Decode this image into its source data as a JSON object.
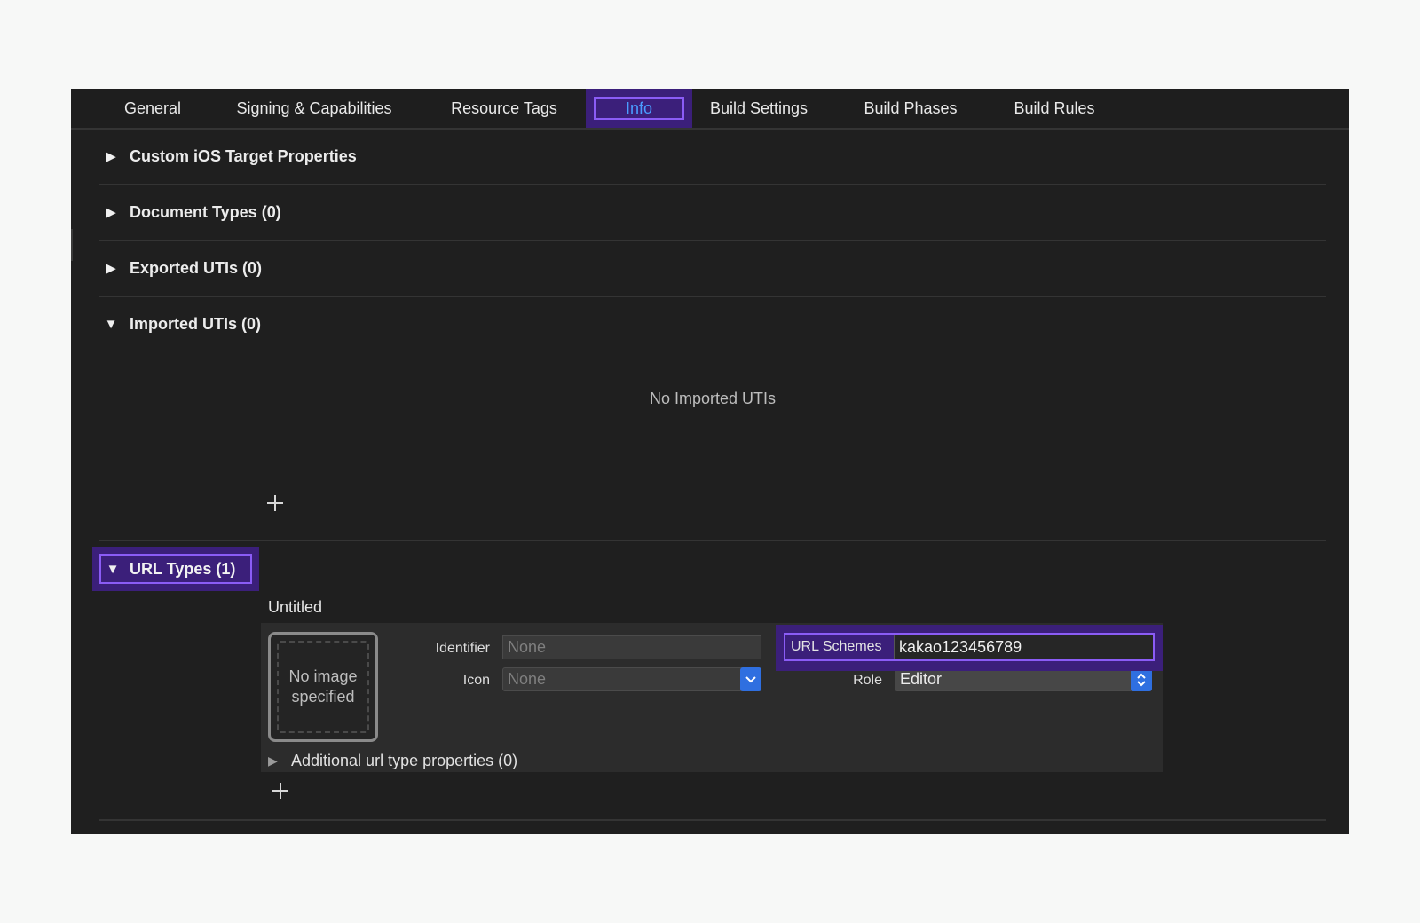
{
  "tabs": [
    {
      "label": "General"
    },
    {
      "label": "Signing & Capabilities"
    },
    {
      "label": "Resource Tags"
    },
    {
      "label": "Info",
      "active": true
    },
    {
      "label": "Build Settings"
    },
    {
      "label": "Build Phases"
    },
    {
      "label": "Build Rules"
    }
  ],
  "sections": {
    "custom_ios": {
      "title": "Custom iOS Target Properties",
      "expanded": false
    },
    "document_types": {
      "title": "Document Types (0)",
      "expanded": false
    },
    "exported_utis": {
      "title": "Exported UTIs (0)",
      "expanded": false
    },
    "imported_utis": {
      "title": "Imported UTIs (0)",
      "expanded": true,
      "empty_text": "No Imported UTIs"
    },
    "url_types": {
      "title": "URL Types (1)",
      "expanded": true
    }
  },
  "url_type": {
    "name": "Untitled",
    "image_placeholder": "No image specified",
    "identifier_label": "Identifier",
    "identifier_placeholder": "None",
    "icon_label": "Icon",
    "icon_value": "None",
    "url_schemes_label": "URL Schemes",
    "url_schemes_value": "kakao123456789",
    "role_label": "Role",
    "role_value": "Editor",
    "additional_properties": "Additional url type properties (0)"
  },
  "colors": {
    "highlight": "#3b1f7a",
    "highlight_border": "#8b5cf6",
    "active_tab_text": "#4a9dff",
    "accent_blue": "#2f6fe0"
  }
}
